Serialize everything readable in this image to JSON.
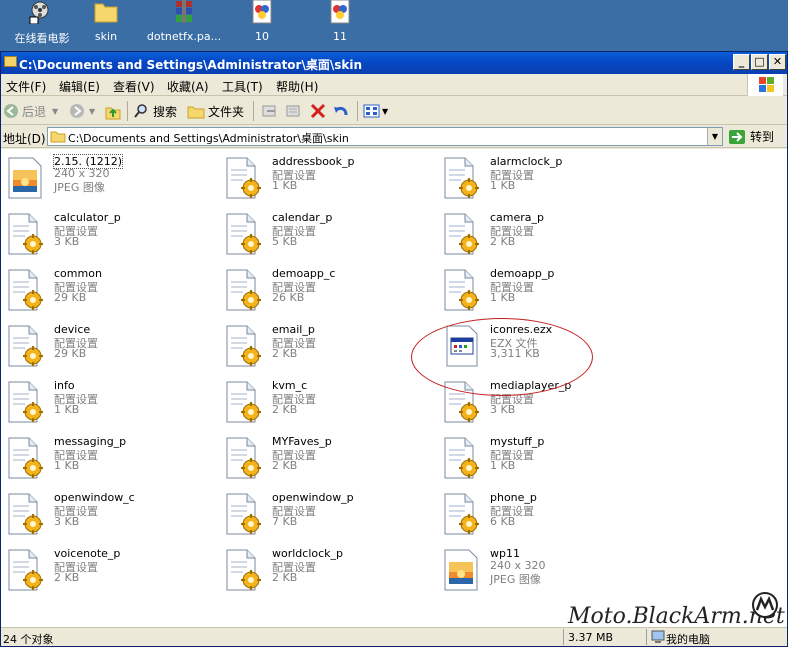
{
  "desktop": {
    "icons": [
      {
        "label": "在线看电影",
        "icon": "film-reel-icon"
      },
      {
        "label": "skin",
        "icon": "folder-icon"
      },
      {
        "label": "dotnetfx.pa...",
        "icon": "rar-archive-icon"
      },
      {
        "label": "10",
        "icon": "image-file-icon"
      },
      {
        "label": "11",
        "icon": "image-file-icon"
      }
    ]
  },
  "window": {
    "title": "C:\\Documents and Settings\\Administrator\\桌面\\skin",
    "buttons": {
      "minimize": "_",
      "maximize": "□",
      "close": "✕"
    }
  },
  "menubar": [
    "文件(F)",
    "编辑(E)",
    "查看(V)",
    "收藏(A)",
    "工具(T)",
    "帮助(H)"
  ],
  "toolbar": {
    "back": "后退",
    "search": "搜索",
    "folders": "文件夹"
  },
  "address": {
    "label": "地址(D)",
    "value": "C:\\Documents and Settings\\Administrator\\桌面\\skin",
    "go": "转到"
  },
  "files": [
    {
      "name": "2.15. (1212)",
      "desc": "240 x 320",
      "size": "JPEG 图像",
      "icon": "jpeg-image-icon"
    },
    {
      "name": "addressbook_p",
      "desc": "配置设置",
      "size": "1 KB",
      "icon": "config-file-icon"
    },
    {
      "name": "alarmclock_p",
      "desc": "配置设置",
      "size": "1 KB",
      "icon": "config-file-icon"
    },
    {
      "name": "calculator_p",
      "desc": "配置设置",
      "size": "3 KB",
      "icon": "config-file-icon"
    },
    {
      "name": "calendar_p",
      "desc": "配置设置",
      "size": "5 KB",
      "icon": "config-file-icon"
    },
    {
      "name": "camera_p",
      "desc": "配置设置",
      "size": "2 KB",
      "icon": "config-file-icon"
    },
    {
      "name": "common",
      "desc": "配置设置",
      "size": "29 KB",
      "icon": "config-file-icon"
    },
    {
      "name": "demoapp_c",
      "desc": "配置设置",
      "size": "26 KB",
      "icon": "config-file-icon"
    },
    {
      "name": "demoapp_p",
      "desc": "配置设置",
      "size": "1 KB",
      "icon": "config-file-icon"
    },
    {
      "name": "device",
      "desc": "配置设置",
      "size": "29 KB",
      "icon": "config-file-icon"
    },
    {
      "name": "email_p",
      "desc": "配置设置",
      "size": "2 KB",
      "icon": "config-file-icon"
    },
    {
      "name": "iconres.ezx",
      "desc": "EZX 文件",
      "size": "3,311 KB",
      "icon": "ezx-file-icon"
    },
    {
      "name": "info",
      "desc": "配置设置",
      "size": "1 KB",
      "icon": "config-file-icon"
    },
    {
      "name": "kvm_c",
      "desc": "配置设置",
      "size": "2 KB",
      "icon": "config-file-icon"
    },
    {
      "name": "mediaplayer_p",
      "desc": "配置设置",
      "size": "3 KB",
      "icon": "config-file-icon"
    },
    {
      "name": "messaging_p",
      "desc": "配置设置",
      "size": "1 KB",
      "icon": "config-file-icon"
    },
    {
      "name": "MYFaves_p",
      "desc": "配置设置",
      "size": "2 KB",
      "icon": "config-file-icon"
    },
    {
      "name": "mystuff_p",
      "desc": "配置设置",
      "size": "1 KB",
      "icon": "config-file-icon"
    },
    {
      "name": "openwindow_c",
      "desc": "配置设置",
      "size": "3 KB",
      "icon": "config-file-icon"
    },
    {
      "name": "openwindow_p",
      "desc": "配置设置",
      "size": "7 KB",
      "icon": "config-file-icon"
    },
    {
      "name": "phone_p",
      "desc": "配置设置",
      "size": "6 KB",
      "icon": "config-file-icon"
    },
    {
      "name": "voicenote_p",
      "desc": "配置设置",
      "size": "2 KB",
      "icon": "config-file-icon"
    },
    {
      "name": "worldclock_p",
      "desc": "配置设置",
      "size": "2 KB",
      "icon": "config-file-icon"
    },
    {
      "name": "wp11",
      "desc": "240 x 320",
      "size": "JPEG 图像",
      "icon": "jpeg-image-icon"
    }
  ],
  "status": {
    "objects": "24 个对象",
    "size": "3.37 MB",
    "location": "我的电脑"
  },
  "watermark": "Moto.BlackArm.net",
  "colors": {
    "titlebar": "#0548c4",
    "desktop": "#3a6ea5",
    "highlight": "#c2201e"
  }
}
